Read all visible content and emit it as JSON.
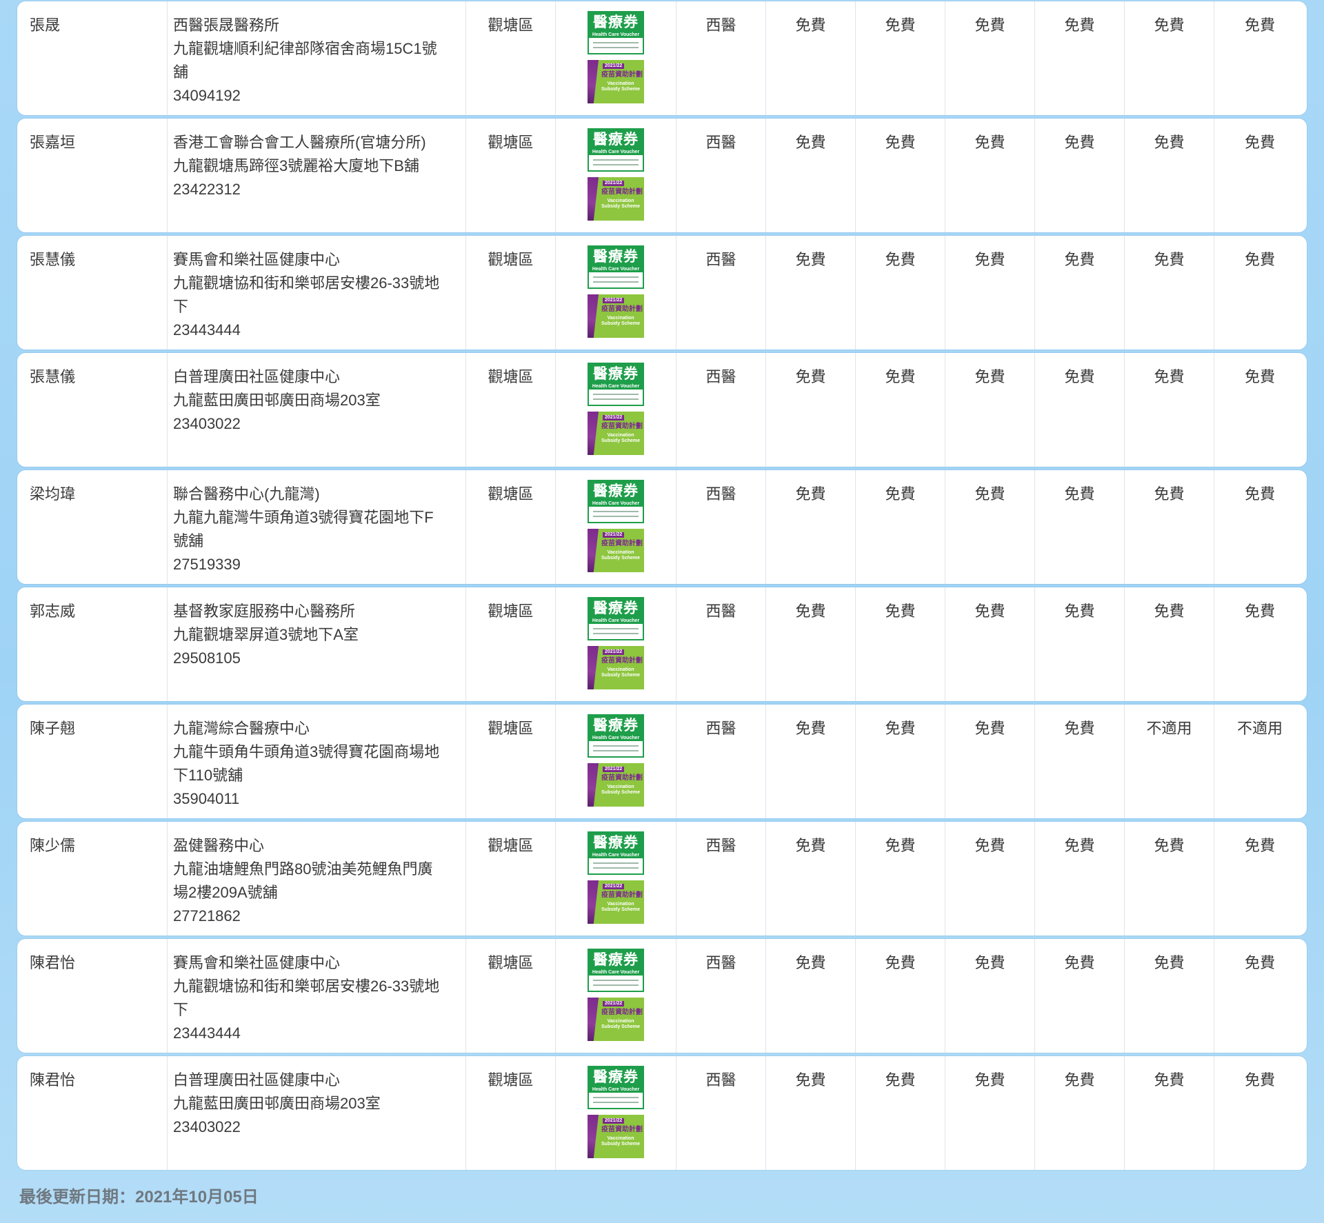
{
  "logos": {
    "hcv_title": "醫療券",
    "hcv_subtitle": "Health Care Voucher",
    "vss_year": "2021/22",
    "vss_title": "疫苗資助計劃",
    "vss_en_1": "Vaccination",
    "vss_en_2": "Subsidy Scheme"
  },
  "rows": [
    {
      "doctor": "張晟",
      "clinic_lines": [
        "西醫張晟醫務所",
        "九龍觀塘順利紀律部隊宿舍商場15C1號",
        "舖",
        "34094192"
      ],
      "district": "觀塘區",
      "type": "西醫",
      "fees": [
        "免費",
        "免費",
        "免費",
        "免費",
        "免費",
        "免費"
      ]
    },
    {
      "doctor": "張嘉垣",
      "clinic_lines": [
        "香港工會聯合會工人醫療所(官塘分所)",
        "九龍觀塘馬蹄徑3號麗裕大廈地下B舖",
        "23422312"
      ],
      "district": "觀塘區",
      "type": "西醫",
      "fees": [
        "免費",
        "免費",
        "免費",
        "免費",
        "免費",
        "免費"
      ]
    },
    {
      "doctor": "張慧儀",
      "clinic_lines": [
        "賽馬會和樂社區健康中心",
        "九龍觀塘協和街和樂邨居安樓26-33號地",
        "下",
        "23443444"
      ],
      "district": "觀塘區",
      "type": "西醫",
      "fees": [
        "免費",
        "免費",
        "免費",
        "免費",
        "免費",
        "免費"
      ]
    },
    {
      "doctor": "張慧儀",
      "clinic_lines": [
        "白普理廣田社區健康中心",
        "九龍藍田廣田邨廣田商場203室",
        "23403022"
      ],
      "district": "觀塘區",
      "type": "西醫",
      "fees": [
        "免費",
        "免費",
        "免費",
        "免費",
        "免費",
        "免費"
      ]
    },
    {
      "doctor": "梁均瑋",
      "clinic_lines": [
        "聯合醫務中心(九龍灣)",
        "九龍九龍灣牛頭角道3號得寶花園地下F",
        "號舖",
        "27519339"
      ],
      "district": "觀塘區",
      "type": "西醫",
      "fees": [
        "免費",
        "免費",
        "免費",
        "免費",
        "免費",
        "免費"
      ]
    },
    {
      "doctor": "郭志威",
      "clinic_lines": [
        "基督教家庭服務中心醫務所",
        "九龍觀塘翠屏道3號地下A室",
        "29508105"
      ],
      "district": "觀塘區",
      "type": "西醫",
      "fees": [
        "免費",
        "免費",
        "免費",
        "免費",
        "免費",
        "免費"
      ]
    },
    {
      "doctor": "陳子翹",
      "clinic_lines": [
        "九龍灣綜合醫療中心",
        "九龍牛頭角牛頭角道3號得寶花園商場地",
        "下110號舖",
        "35904011"
      ],
      "district": "觀塘區",
      "type": "西醫",
      "fees": [
        "免費",
        "免費",
        "免費",
        "免費",
        "不適用",
        "不適用"
      ]
    },
    {
      "doctor": "陳少儒",
      "clinic_lines": [
        "盈健醫務中心",
        "九龍油塘鯉魚門路80號油美苑鯉魚門廣",
        "場2樓209A號舖",
        "27721862"
      ],
      "district": "觀塘區",
      "type": "西醫",
      "fees": [
        "免費",
        "免費",
        "免費",
        "免費",
        "免費",
        "免費"
      ]
    },
    {
      "doctor": "陳君怡",
      "clinic_lines": [
        "賽馬會和樂社區健康中心",
        "九龍觀塘協和街和樂邨居安樓26-33號地",
        "下",
        "23443444"
      ],
      "district": "觀塘區",
      "type": "西醫",
      "fees": [
        "免費",
        "免費",
        "免費",
        "免費",
        "免費",
        "免費"
      ]
    },
    {
      "doctor": "陳君怡",
      "clinic_lines": [
        "白普理廣田社區健康中心",
        "九龍藍田廣田邨廣田商場203室",
        "23403022"
      ],
      "district": "觀塘區",
      "type": "西醫",
      "fees": [
        "免費",
        "免費",
        "免費",
        "免費",
        "免費",
        "免費"
      ]
    }
  ],
  "footer": {
    "last_updated": "最後更新日期：2021年10月05日"
  }
}
